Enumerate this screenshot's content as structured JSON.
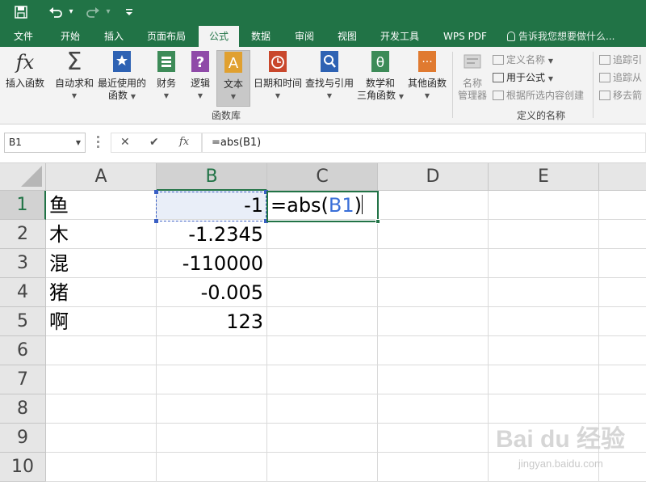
{
  "titlebar": {
    "undo_caret": "▾",
    "customize_caret": "▾"
  },
  "tabs": [
    {
      "label": "文件",
      "name": "tab-file"
    },
    {
      "label": "开始",
      "name": "tab-home"
    },
    {
      "label": "插入",
      "name": "tab-insert"
    },
    {
      "label": "页面布局",
      "name": "tab-page-layout"
    },
    {
      "label": "公式",
      "name": "tab-formulas",
      "active": true
    },
    {
      "label": "数据",
      "name": "tab-data"
    },
    {
      "label": "审阅",
      "name": "tab-review"
    },
    {
      "label": "视图",
      "name": "tab-view"
    },
    {
      "label": "开发工具",
      "name": "tab-developer"
    },
    {
      "label": "WPS PDF",
      "name": "tab-wps-pdf"
    }
  ],
  "tellme": "告诉我您想要做什么...",
  "ribbon": {
    "insert_function": {
      "icon_text": "fx",
      "label": "插入函数"
    },
    "autosum": {
      "label": "自动求和"
    },
    "recent": {
      "label_line1": "最近使用的",
      "label_line2": "函数"
    },
    "financial": {
      "label": "财务"
    },
    "logical": {
      "label": "逻辑"
    },
    "text": {
      "label": "文本"
    },
    "datetime": {
      "label": "日期和时间"
    },
    "lookup": {
      "label": "查找与引用"
    },
    "math": {
      "label_line1": "数学和",
      "label_line2": "三角函数"
    },
    "more": {
      "label": "其他函数"
    },
    "group_library": "函数库",
    "name_manager": {
      "label_line1": "名称",
      "label_line2": "管理器"
    },
    "define_name": "定义名称",
    "use_in_formula": "用于公式",
    "create_from_selection": "根据所选内容创建",
    "group_names": "定义的名称",
    "trace_precedents": "追踪引",
    "trace_dependents": "追踪从",
    "remove_arrows": "移去箭"
  },
  "formula_bar": {
    "name_box": "B1",
    "cancel": "✕",
    "enter": "✔",
    "fx": "fx",
    "formula": "=abs(B1)"
  },
  "sheet": {
    "columns": [
      "A",
      "B",
      "C",
      "D",
      "E"
    ],
    "rows": [
      "1",
      "2",
      "3",
      "4",
      "5",
      "6",
      "7",
      "8",
      "9",
      "10"
    ],
    "colA": [
      "鱼",
      "木",
      "混",
      "猪",
      "啊"
    ],
    "colB": [
      "-1",
      "-1.2345",
      "-110000",
      "-0.005",
      "123"
    ],
    "edit_prefix": "=abs(",
    "edit_ref": "B1",
    "edit_suffix": ")"
  },
  "watermark": {
    "logo": "Bai du 经验",
    "url": "jingyan.baidu.com"
  },
  "colors": {
    "accent": "#217346",
    "ref_blue": "#3a6fd8"
  }
}
